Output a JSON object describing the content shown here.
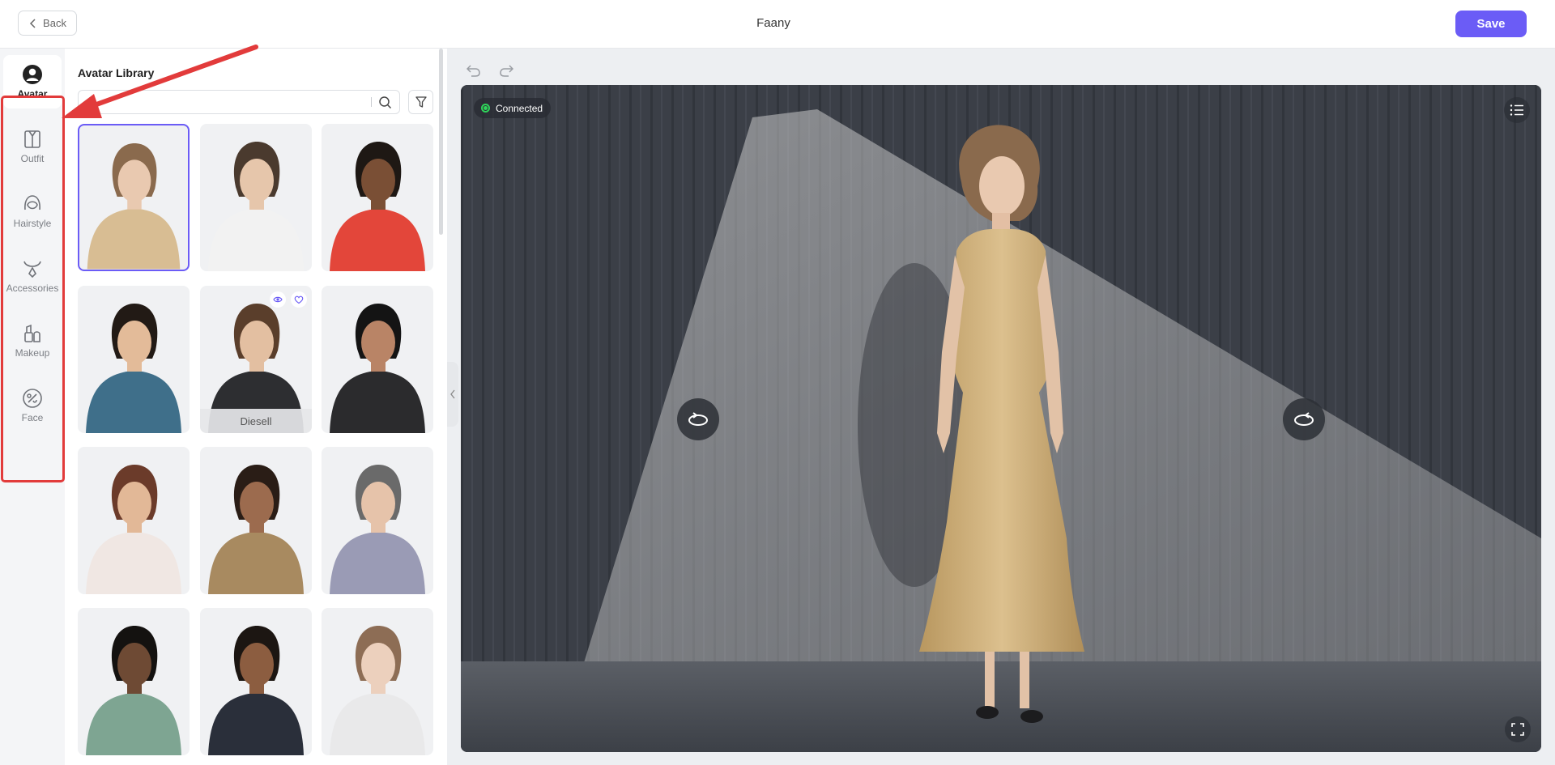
{
  "header": {
    "back_label": "Back",
    "title": "Faany",
    "save_label": "Save"
  },
  "rail": {
    "items": [
      {
        "label": "Avatar",
        "icon": "user-circle-icon",
        "active": true
      },
      {
        "label": "Outfit",
        "icon": "shirt-icon",
        "active": false
      },
      {
        "label": "Hairstyle",
        "icon": "hairstyle-icon",
        "active": false
      },
      {
        "label": "Accessories",
        "icon": "necklace-icon",
        "active": false
      },
      {
        "label": "Makeup",
        "icon": "makeup-icon",
        "active": false
      },
      {
        "label": "Face",
        "icon": "face-icon",
        "active": false
      }
    ]
  },
  "library": {
    "title": "Avatar Library",
    "search_placeholder": "",
    "cards": [
      {
        "selected": true,
        "hair": "#8a6a4d",
        "skin": "#e9c9b0",
        "top": "#d8bd93"
      },
      {
        "selected": false,
        "hair": "#4a3a2e",
        "skin": "#e6c6ab",
        "top": "#f2f2f2"
      },
      {
        "selected": false,
        "hair": "#1e1814",
        "skin": "#7a4f35",
        "top": "#e3463a"
      },
      {
        "selected": false,
        "hair": "#221a15",
        "skin": "#e3bb99",
        "top": "#3f6f8a"
      },
      {
        "selected": false,
        "hair": "#5a3e2b",
        "skin": "#e3bfa1",
        "top": "#2d2e31",
        "name": "Diesell"
      },
      {
        "selected": false,
        "hair": "#141414",
        "skin": "#b98466",
        "top": "#2b2b2d"
      },
      {
        "selected": false,
        "hair": "#6b3b2a",
        "skin": "#e2b897",
        "top": "#f0e7e3"
      },
      {
        "selected": false,
        "hair": "#2a1d16",
        "skin": "#9c6b4e",
        "top": "#a88a60"
      },
      {
        "selected": false,
        "hair": "#6a6a6a",
        "skin": "#e6c3aa",
        "top": "#9a9bb5"
      },
      {
        "selected": false,
        "hair": "#141210",
        "skin": "#6e4a34",
        "top": "#7ea592"
      },
      {
        "selected": false,
        "hair": "#1c1612",
        "skin": "#8c5d40",
        "top": "#2a2f3a"
      },
      {
        "selected": false,
        "hair": "#8d6d55",
        "skin": "#ecd0bd",
        "top": "#e9e9ea"
      }
    ]
  },
  "viewport": {
    "status": "Connected",
    "status_color": "#2fd35a",
    "accent": "#6b5cf6"
  }
}
